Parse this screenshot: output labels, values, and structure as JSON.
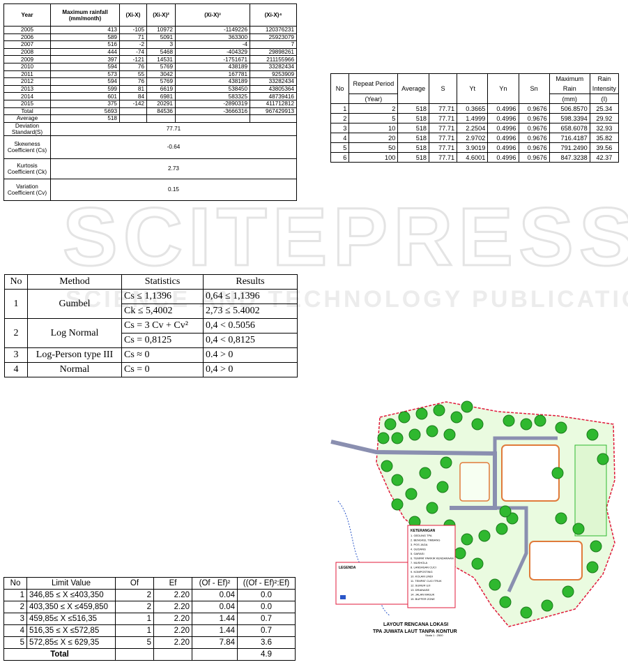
{
  "watermark": {
    "line1": "SCITEPRESS",
    "line2": "SCIENCE AND TECHNOLOGY PUBLICATIONS"
  },
  "rainfall_table": {
    "headers": [
      "Year",
      "Maximum rainfall (mm/month)",
      "(Xi-X)",
      "(Xi-X)²",
      "(Xi-X)³",
      "(Xi-X)⁴"
    ],
    "rows": [
      [
        "2005",
        "413",
        "-105",
        "10972",
        "-1149226",
        "120376231"
      ],
      [
        "2006",
        "589",
        "71",
        "5091",
        "363300",
        "25923079"
      ],
      [
        "2007",
        "516",
        "-2",
        "3",
        "-4",
        "7"
      ],
      [
        "2008",
        "444",
        "-74",
        "5468",
        "-404329",
        "29898261"
      ],
      [
        "2009",
        "397",
        "-121",
        "14531",
        "-1751671",
        "211155966"
      ],
      [
        "2010",
        "594",
        "76",
        "5769",
        "438189",
        "33282434"
      ],
      [
        "2011",
        "573",
        "55",
        "3042",
        "167781",
        "9253909"
      ],
      [
        "2012",
        "594",
        "76",
        "5769",
        "438189",
        "33282434"
      ],
      [
        "2013",
        "599",
        "81",
        "6619",
        "538450",
        "43805364"
      ],
      [
        "2014",
        "601",
        "84",
        "6981",
        "583325",
        "48739416"
      ],
      [
        "2015",
        "375",
        "-142",
        "20291",
        "-2890319",
        "411712812"
      ]
    ],
    "total": [
      "Total",
      "5693",
      "",
      "84536",
      "-3666316",
      "967429913"
    ],
    "average": [
      "Average",
      "518"
    ],
    "stats": [
      {
        "label": "Deviation Standard(S)",
        "value": "77.71"
      },
      {
        "label": "Skewness Coefficient (Cs)",
        "value": "-0.64"
      },
      {
        "label": "Kurtosis Coefficient (Ck)",
        "value": "2.73"
      },
      {
        "label": "Variation Coefficient (Cv)",
        "value": "0.15"
      }
    ]
  },
  "intensity_table": {
    "headers": [
      "No",
      "Repeat Period",
      "Average",
      "S",
      "Yt",
      "Yn",
      "Sn",
      "Maximum Rain",
      "Rain Intensity"
    ],
    "subheaders": [
      "(Year)",
      "(mm)",
      "(I)"
    ],
    "rows": [
      [
        "1",
        "2",
        "518",
        "77.71",
        "0.3665",
        "0.4996",
        "0.9676",
        "506.8570",
        "25.34"
      ],
      [
        "2",
        "5",
        "518",
        "77.71",
        "1.4999",
        "0.4996",
        "0.9676",
        "598.3394",
        "29.92"
      ],
      [
        "3",
        "10",
        "518",
        "77.71",
        "2.2504",
        "0.4996",
        "0.9676",
        "658.6078",
        "32.93"
      ],
      [
        "4",
        "20",
        "518",
        "77.71",
        "2.9702",
        "0.4996",
        "0.9676",
        "716.4187",
        "35.82"
      ],
      [
        "5",
        "50",
        "518",
        "77.71",
        "3.9019",
        "0.4996",
        "0.9676",
        "791.2490",
        "39.56"
      ],
      [
        "6",
        "100",
        "518",
        "77.71",
        "4.6001",
        "0.4996",
        "0.9676",
        "847.3238",
        "42.37"
      ]
    ]
  },
  "method_table": {
    "headers": [
      "No",
      "Method",
      "Statistics",
      "Results"
    ],
    "rows": [
      {
        "no": "1",
        "method": "Gumbel",
        "stats": [
          "Cs ≤ 1,1396",
          "Ck ≤ 5,4002"
        ],
        "results": [
          "0,64 ≤ 1,1396",
          "2,73 ≤ 5.4002"
        ]
      },
      {
        "no": "2",
        "method": "Log Normal",
        "stats": [
          "Cs = 3 Cv + Cv²",
          "Cs = 0,8125"
        ],
        "results": [
          "0,4 < 0.5056",
          "0,4 < 0,8125"
        ]
      },
      {
        "no": "3",
        "method": "Log-Person type III",
        "stats": [
          "Cs ≈ 0"
        ],
        "results": [
          "0.4 > 0"
        ]
      },
      {
        "no": "4",
        "method": "Normal",
        "stats": [
          "Cs = 0"
        ],
        "results": [
          "0,4 > 0"
        ]
      }
    ]
  },
  "chi_table": {
    "headers": [
      "No",
      "Limit Value",
      "Of",
      "Ef",
      "(Of - Ef)²",
      "((Of - Ef)²:Ef)"
    ],
    "rows": [
      [
        "1",
        "346,85 ≤ X ≤403,350",
        "2",
        "2.20",
        "0.04",
        "0.0"
      ],
      [
        "2",
        "403,350 ≤ X ≤459,850",
        "2",
        "2.20",
        "0.04",
        "0.0"
      ],
      [
        "3",
        "459,85≤ X ≤516,35",
        "1",
        "2.20",
        "1.44",
        "0.7"
      ],
      [
        "4",
        "516,35 ≤ X ≤572,85",
        "1",
        "2.20",
        "1.44",
        "0.7"
      ],
      [
        "5",
        "572,85≤ X ≤ 629,35",
        "5",
        "2.20",
        "7.84",
        "3.6"
      ]
    ],
    "total_label": "Total",
    "total_value": "4.9"
  },
  "map": {
    "title_line1": "LAYOUT RENCANA LOKASI",
    "title_line2": "TPA JUWATA LAUT TANPA KONTUR",
    "scale": "Skala 1 : 2500",
    "legend_title": "KETERANGAN",
    "legend_items": [
      "1. GEDUNG TPA",
      "2. BENGKEL TIMBANG",
      "3. POS JAGA",
      "4. GUDANG",
      "5. GARASI",
      "6. TEMPAT PARKIR KENDARAAN",
      "7. MUSHOLA",
      "8. LANDASAN CUCI",
      "9. KOMPOSTING",
      "10. KOLAM LINDI",
      "11. TEMPAT CUCI TRUK",
      "12. SUMUR UJI",
      "13. DRAINASE",
      "14. JALAN MASUK",
      "15. BUFFER ZONE"
    ],
    "legend2_title": "LEGENDA",
    "colors": {
      "tree": "#2fb82f",
      "tree_dark": "#1b7a1b",
      "ground": "#eafbe0",
      "road": "#8a8fb0",
      "fence": "#e0193a",
      "water": "#2a56c8"
    }
  }
}
